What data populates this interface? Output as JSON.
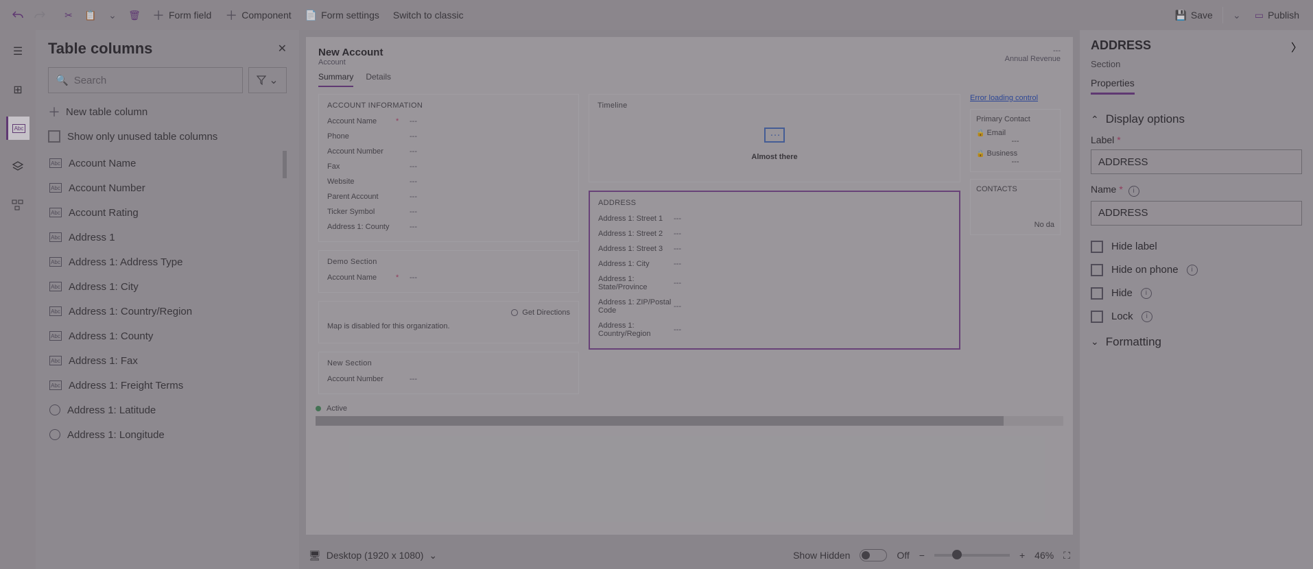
{
  "toolbar": {
    "form_field": "Form field",
    "component": "Component",
    "form_settings": "Form settings",
    "switch": "Switch to classic",
    "save": "Save",
    "publish": "Publish"
  },
  "columns_panel": {
    "title": "Table columns",
    "search_placeholder": "Search",
    "new_column": "New table column",
    "show_unused": "Show only unused table columns",
    "items": [
      "Account Name",
      "Account Number",
      "Account Rating",
      "Address 1",
      "Address 1: Address Type",
      "Address 1: City",
      "Address 1: Country/Region",
      "Address 1: County",
      "Address 1: Fax",
      "Address 1: Freight Terms",
      "Address 1: Latitude",
      "Address 1: Longitude"
    ]
  },
  "canvas": {
    "title": "New Account",
    "subtitle": "Account",
    "revenue_label": "Annual Revenue",
    "tabs": [
      "Summary",
      "Details"
    ],
    "acct_info": {
      "title": "ACCOUNT INFORMATION",
      "fields": [
        {
          "label": "Account Name",
          "required": true,
          "value": "---"
        },
        {
          "label": "Phone",
          "required": false,
          "value": "---"
        },
        {
          "label": "Account Number",
          "required": false,
          "value": "---"
        },
        {
          "label": "Fax",
          "required": false,
          "value": "---"
        },
        {
          "label": "Website",
          "required": false,
          "value": "---"
        },
        {
          "label": "Parent Account",
          "required": false,
          "value": "---"
        },
        {
          "label": "Ticker Symbol",
          "required": false,
          "value": "---"
        },
        {
          "label": "Address 1: County",
          "required": false,
          "value": "---"
        }
      ]
    },
    "demo": {
      "title": "Demo Section",
      "fields": [
        {
          "label": "Account Name",
          "required": true,
          "value": "---"
        }
      ]
    },
    "map_card": {
      "get_directions": "Get Directions",
      "disabled": "Map is disabled for this organization."
    },
    "new_sect": {
      "title": "New Section",
      "fields": [
        {
          "label": "Account Number",
          "required": false,
          "value": "---"
        }
      ]
    },
    "timeline": {
      "title": "Timeline",
      "text": "Almost there"
    },
    "address": {
      "title": "ADDRESS",
      "fields": [
        {
          "label": "Address 1: Street 1",
          "value": "---"
        },
        {
          "label": "Address 1: Street 2",
          "value": "---"
        },
        {
          "label": "Address 1: Street 3",
          "value": "---"
        },
        {
          "label": "Address 1: City",
          "value": "---"
        },
        {
          "label": "Address 1: State/Province",
          "value": "---"
        },
        {
          "label": "Address 1: ZIP/Postal Code",
          "value": "---"
        },
        {
          "label": "Address 1: Country/Region",
          "value": "---"
        }
      ]
    },
    "side": {
      "error": "Error loading control",
      "primary": "Primary Contact",
      "email": "Email",
      "email_v": "---",
      "business": "Business",
      "business_v": "---",
      "contacts": "CONTACTS",
      "nodata": "No da"
    },
    "footer_status": "Active",
    "desktop": "Desktop (1920 x 1080)",
    "show_hidden": "Show Hidden",
    "off": "Off",
    "zoom": "46%"
  },
  "props": {
    "title": "ADDRESS",
    "subtitle": "Section",
    "tab": "Properties",
    "display_options": "Display options",
    "label_lbl": "Label",
    "label_val": "ADDRESS",
    "name_lbl": "Name",
    "name_val": "ADDRESS",
    "hide_label": "Hide label",
    "hide_phone": "Hide on phone",
    "hide": "Hide",
    "lock": "Lock",
    "formatting": "Formatting"
  }
}
